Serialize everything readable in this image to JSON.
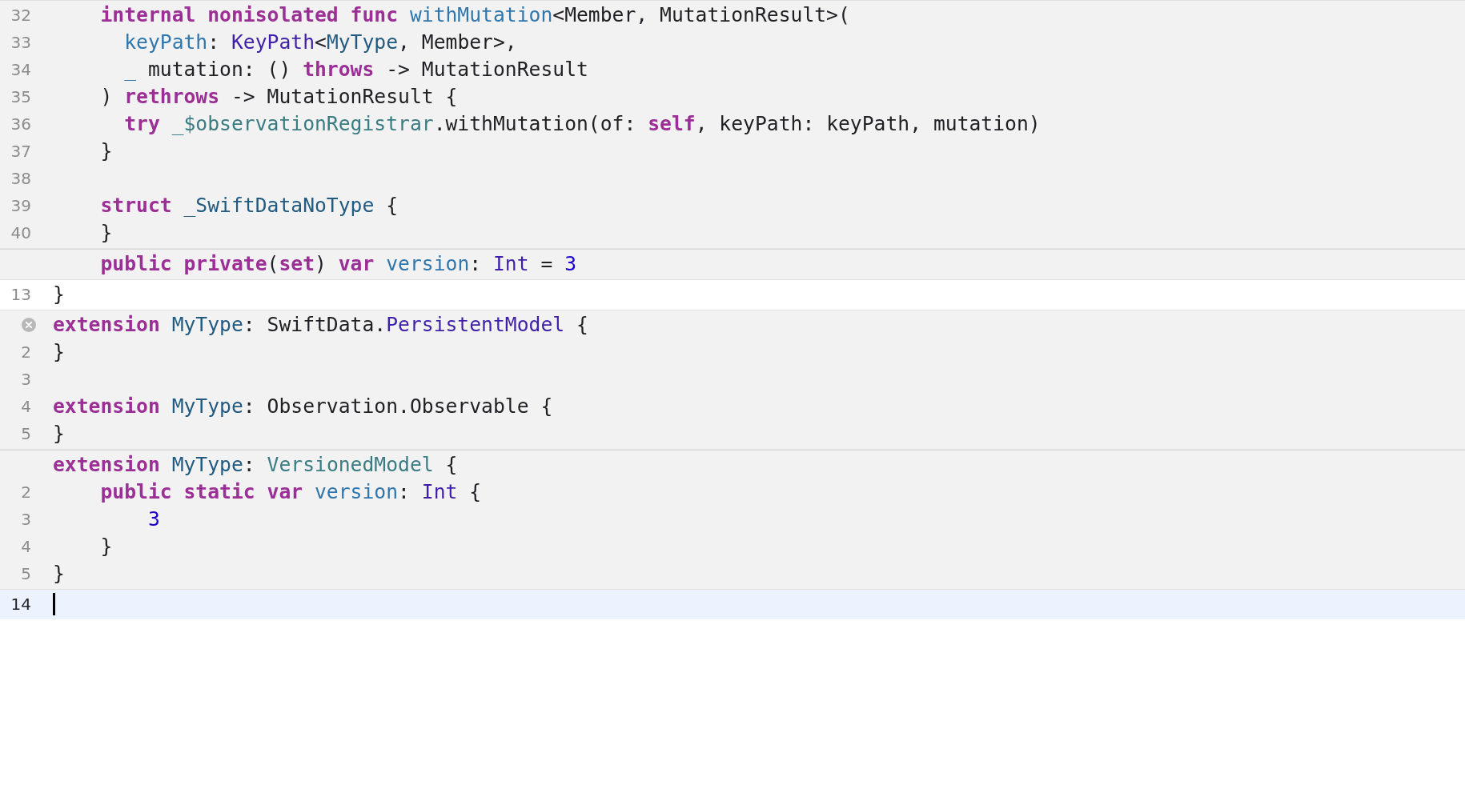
{
  "editor": {
    "blocks": [
      {
        "kind": "expansion",
        "lines": [
          {
            "number": "32",
            "has_error": false,
            "tokens": [
              {
                "text": "    internal nonisolated func ",
                "kind": "keyword"
              },
              {
                "text": "withMutation",
                "kind": "declaration"
              },
              {
                "text": "<Member, MutationResult>("
              }
            ]
          },
          {
            "number": "33",
            "has_error": false,
            "tokens": [
              {
                "text": "      keyPath",
                "kind": "declaration"
              },
              {
                "text": ": "
              },
              {
                "text": "KeyPath",
                "kind": "system-type"
              },
              {
                "text": "<"
              },
              {
                "text": "MyType",
                "kind": "project-type"
              },
              {
                "text": ", Member>,"
              }
            ]
          },
          {
            "number": "34",
            "has_error": false,
            "tokens": [
              {
                "text": "      _",
                "kind": "declaration"
              },
              {
                "text": " mutation: () "
              },
              {
                "text": "throws",
                "kind": "keyword"
              },
              {
                "text": " -> MutationResult"
              }
            ]
          },
          {
            "number": "35",
            "has_error": false,
            "tokens": [
              {
                "text": "    ) "
              },
              {
                "text": "rethrows",
                "kind": "keyword"
              },
              {
                "text": " -> MutationResult {"
              }
            ]
          },
          {
            "number": "36",
            "has_error": false,
            "tokens": [
              {
                "text": "      try ",
                "kind": "keyword"
              },
              {
                "text": "_$observationRegistrar",
                "kind": "project-member"
              },
              {
                "text": ".withMutation(of: "
              },
              {
                "text": "self",
                "kind": "keyword"
              },
              {
                "text": ", keyPath: keyPath, mutation)"
              }
            ]
          },
          {
            "number": "37",
            "has_error": false,
            "tokens": [
              {
                "text": "    }"
              }
            ]
          },
          {
            "number": "38",
            "has_error": false
          },
          {
            "number": "39",
            "has_error": false,
            "tokens": [
              {
                "text": "    struct ",
                "kind": "keyword"
              },
              {
                "text": "_SwiftDataNoType",
                "kind": "project-type"
              },
              {
                "text": " {"
              }
            ]
          },
          {
            "number": "40",
            "has_error": false,
            "tokens": [
              {
                "text": "    }"
              }
            ]
          }
        ]
      },
      {
        "kind": "expansion",
        "lines": [
          {
            "has_error": false,
            "tokens": [
              {
                "text": "    public private",
                "kind": "keyword"
              },
              {
                "text": "("
              },
              {
                "text": "set",
                "kind": "keyword"
              },
              {
                "text": ") "
              },
              {
                "text": "var ",
                "kind": "keyword"
              },
              {
                "text": "version",
                "kind": "declaration"
              },
              {
                "text": ": "
              },
              {
                "text": "Int",
                "kind": "system-type"
              },
              {
                "text": " = "
              },
              {
                "text": "3",
                "kind": "number"
              }
            ]
          }
        ]
      },
      {
        "kind": "source",
        "lines": [
          {
            "number": "13",
            "has_error": false,
            "tokens": [
              {
                "text": "}"
              }
            ]
          }
        ]
      },
      {
        "kind": "expansion",
        "lines": [
          {
            "has_error": true,
            "tokens": [
              {
                "text": "extension ",
                "kind": "keyword"
              },
              {
                "text": "MyType",
                "kind": "project-type"
              },
              {
                "text": ": SwiftData."
              },
              {
                "text": "PersistentModel",
                "kind": "system-type"
              },
              {
                "text": " {"
              }
            ]
          },
          {
            "number": "2",
            "has_error": false,
            "tokens": [
              {
                "text": "}"
              }
            ]
          },
          {
            "number": "3",
            "has_error": false
          },
          {
            "number": "4",
            "has_error": false,
            "tokens": [
              {
                "text": "extension ",
                "kind": "keyword"
              },
              {
                "text": "MyType",
                "kind": "project-type"
              },
              {
                "text": ": Observation.Observable {"
              }
            ]
          },
          {
            "number": "5",
            "has_error": false,
            "tokens": [
              {
                "text": "}"
              }
            ]
          }
        ]
      },
      {
        "kind": "expansion",
        "lines": [
          {
            "has_error": false,
            "tokens": [
              {
                "text": "extension ",
                "kind": "keyword"
              },
              {
                "text": "MyType",
                "kind": "project-type"
              },
              {
                "text": ": "
              },
              {
                "text": "VersionedModel",
                "kind": "project-member"
              },
              {
                "text": " {"
              }
            ]
          },
          {
            "number": "2",
            "has_error": false,
            "tokens": [
              {
                "text": "    public static var ",
                "kind": "keyword"
              },
              {
                "text": "version",
                "kind": "declaration"
              },
              {
                "text": ": "
              },
              {
                "text": "Int",
                "kind": "system-type"
              },
              {
                "text": " {"
              }
            ]
          },
          {
            "number": "3",
            "has_error": false,
            "tokens": [
              {
                "text": "        3",
                "kind": "number"
              }
            ]
          },
          {
            "number": "4",
            "has_error": false,
            "tokens": [
              {
                "text": "    }"
              }
            ]
          },
          {
            "number": "5",
            "has_error": false,
            "tokens": [
              {
                "text": "}"
              }
            ]
          }
        ]
      },
      {
        "kind": "current",
        "lines": [
          {
            "number": "14",
            "has_error": false
          }
        ]
      }
    ]
  }
}
